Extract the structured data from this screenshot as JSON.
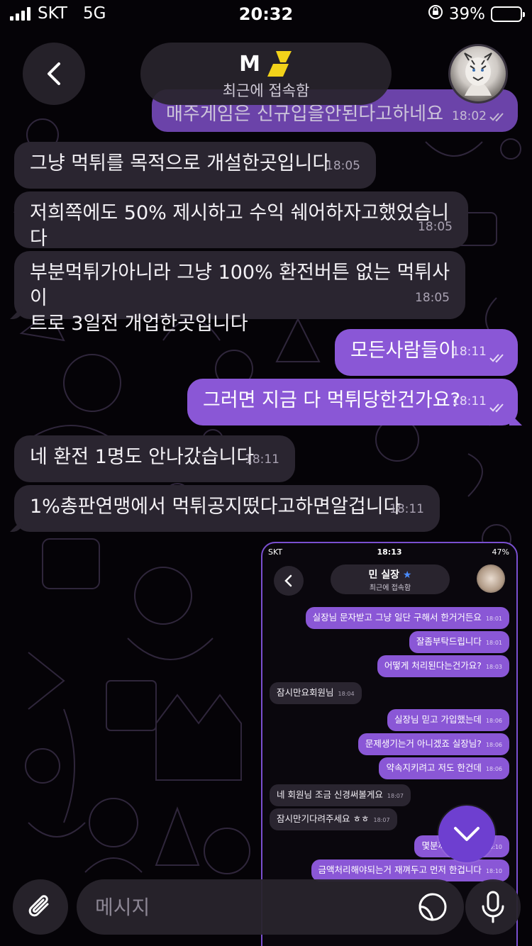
{
  "status_bar": {
    "carrier": "SKT",
    "network": "5G",
    "time": "20:32",
    "battery": "39%",
    "battery_level": 0.39
  },
  "header": {
    "contact_name": "M",
    "status": "최근에 접속함"
  },
  "partial_message": {
    "text": "매주게임은 신규입을안된다고하네요",
    "time": "18:02"
  },
  "messages": [
    {
      "dir": "in",
      "text": "그냥 먹튀를 목적으로 개설한곳입니다",
      "time": "18:05"
    },
    {
      "dir": "in",
      "text": "저희쪽에도 50% 제시하고 수익 쉐어하자고했었습니다",
      "time": "18:05"
    },
    {
      "dir": "in",
      "line1": "부분먹튀가아니라 그냥 100% 환전버튼 없는 먹튀사이",
      "line2": "트로 3일전 개업한곳입니다",
      "time": "18:05"
    },
    {
      "dir": "out",
      "text": "모든사람들이",
      "time": "18:11"
    },
    {
      "dir": "out",
      "text": "그러면 지금 다 먹튀당한건가요?",
      "time": "18:11"
    },
    {
      "dir": "in",
      "text": "네 환전 1명도 안나갔습니다",
      "time": "18:11"
    },
    {
      "dir": "in",
      "text": "1%총판연맹에서 먹튀공지떴다고하면알겁니다",
      "time": "18:11"
    }
  ],
  "embedded_screenshot": {
    "carrier": "SKT",
    "time": "18:13",
    "battery": "47%",
    "title": "민 실장",
    "status": "최근에 접속함",
    "messages": [
      {
        "dir": "out",
        "text": "실장님 문자받고 그냥 일단 구해서 한거거든요",
        "time": "18:01"
      },
      {
        "dir": "out",
        "text": "잘좀부탁드립니다",
        "time": "18:01"
      },
      {
        "dir": "out",
        "text": "어떻게 처리된다는건가요?",
        "time": "18:03"
      },
      {
        "dir": "in",
        "text": "잠시만요회원님",
        "time": "18:04"
      },
      {
        "dir": "out",
        "text": "실장님 믿고 가입했는데",
        "time": "18:06"
      },
      {
        "dir": "out",
        "text": "문제생기는거 아니겠죠 실장님?",
        "time": "18:06"
      },
      {
        "dir": "out",
        "text": "약속지키려고 저도 한건데",
        "time": "18:06"
      },
      {
        "dir": "in",
        "text": "네 회원님 조금 신경써볼게요",
        "time": "18:07"
      },
      {
        "dir": "in",
        "text": "잠시만기다려주세요 ㅎㅎ",
        "time": "18:07"
      },
      {
        "dir": "out",
        "text": "몇분까지 기다려",
        "time": "18:10"
      },
      {
        "dir": "out",
        "text": "금액처리해야되는거 재껴두고 먼저 한겁니다",
        "time": "18:10"
      }
    ]
  },
  "input": {
    "placeholder": "메시지"
  },
  "colors": {
    "outgoing_bubble": "#8a57d6",
    "incoming_bubble": "#2a2530",
    "fab": "#6e3fd0"
  }
}
